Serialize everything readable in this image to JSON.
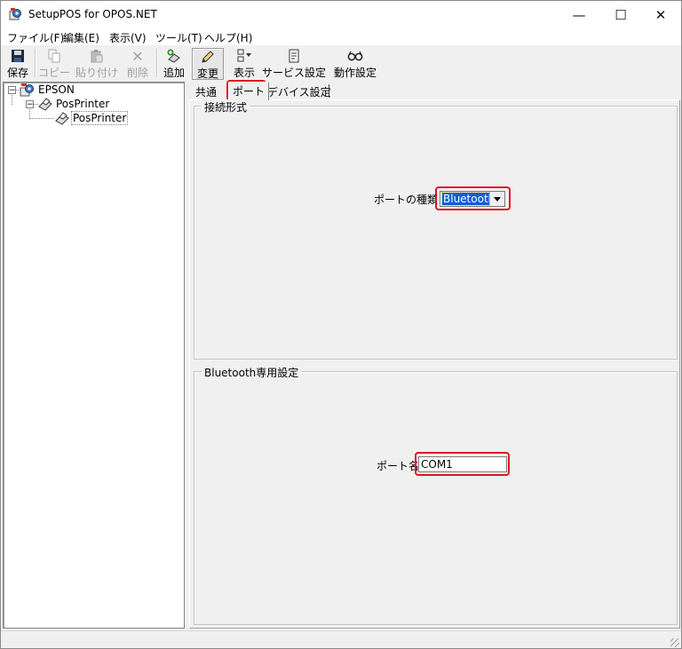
{
  "window": {
    "title": "SetupPOS for OPOS.NET",
    "controls": {
      "minimize": "—",
      "maximize": "☐",
      "close": "✕"
    }
  },
  "menu": [
    "ファイル(F)",
    "編集(E)",
    "表示(V)",
    "ツール(T)",
    "ヘルプ(H)"
  ],
  "toolbar": {
    "save": "保存",
    "copy": "コピー",
    "paste": "貼り付け",
    "delete": "削除",
    "add": "追加",
    "change": "変更",
    "view": "表示",
    "service_settings": "サービス設定",
    "operation_settings": "動作設定"
  },
  "tree": {
    "root": {
      "label": "EPSON",
      "expander": "−"
    },
    "category": {
      "label": "PosPrinter",
      "expander": "−"
    },
    "device": {
      "label": "PosPrinter"
    }
  },
  "tabs": [
    "共通",
    "ポート",
    "デバイス設定"
  ],
  "active_tab_index": 1,
  "connection_group": {
    "title": "接続形式",
    "port_type_label": "ポートの種類",
    "port_type_value": "Bluetooth"
  },
  "bluetooth_group": {
    "title": "Bluetooth専用設定",
    "port_name_label": "ポート名",
    "port_name_value": "COM1"
  },
  "colors": {
    "highlight": "#e0141e",
    "selection": "#0a5fd6",
    "face": "#f0f0f0"
  }
}
